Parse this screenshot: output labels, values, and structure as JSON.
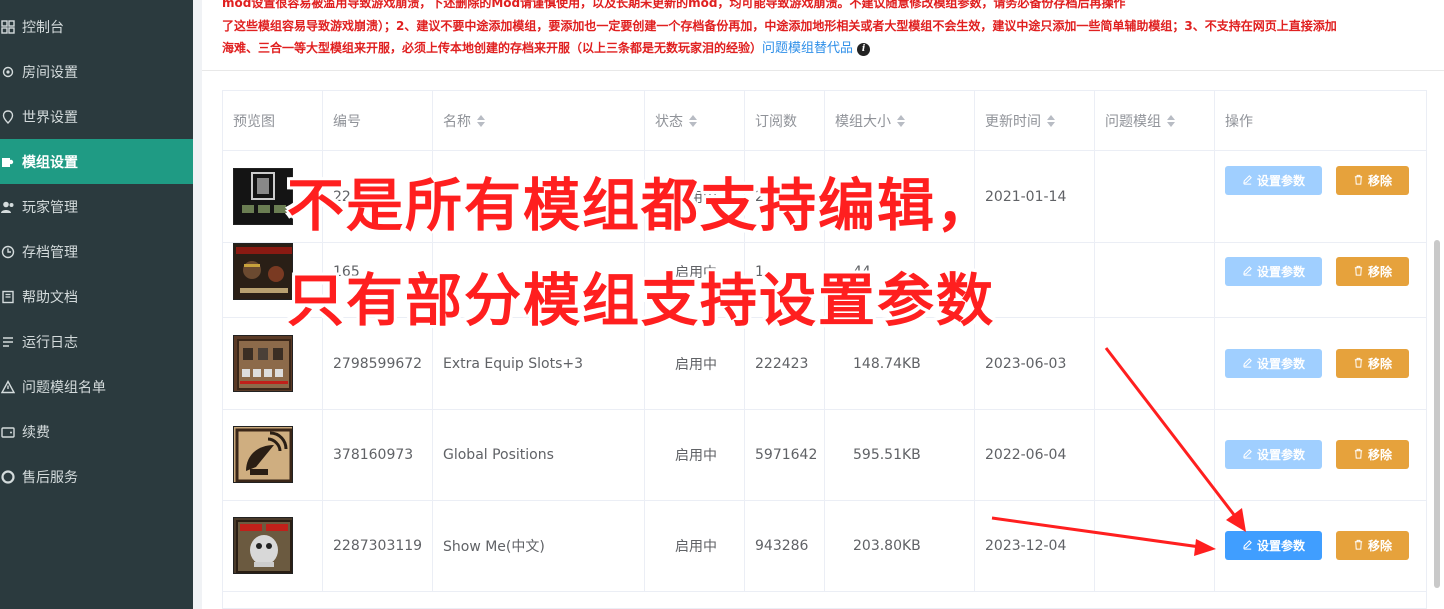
{
  "sidebar": {
    "items": [
      {
        "label": "控制台",
        "icon": "dashboard-icon",
        "active": false
      },
      {
        "label": "房间设置",
        "icon": "gear-icon",
        "active": false
      },
      {
        "label": "世界设置",
        "icon": "location-pin-icon",
        "active": false
      },
      {
        "label": "模组设置",
        "icon": "puzzle-icon",
        "active": true
      },
      {
        "label": "玩家管理",
        "icon": "users-icon",
        "active": false
      },
      {
        "label": "存档管理",
        "icon": "clock-icon",
        "active": false
      },
      {
        "label": "帮助文档",
        "icon": "book-icon",
        "active": false
      },
      {
        "label": "运行日志",
        "icon": "log-icon",
        "active": false
      },
      {
        "label": "问题模组名单",
        "icon": "alert-icon",
        "active": false
      },
      {
        "label": "续费",
        "icon": "wallet-icon",
        "active": false
      },
      {
        "label": "售后服务",
        "icon": "support-icon",
        "active": false
      }
    ]
  },
  "notice": {
    "line1": "mod设置很容易被滥用导致游戏崩溃，下述删除的Mod请谨慎使用，以及长期未更新的mod，均可能导致游戏崩溃。不建议随意修改模组参数，请务必备份存档后再操作",
    "line2": "了这些模组容易导致游戏崩溃）；2、建议不要中途添加模组，要添加也一定要创建一个存档备份再加，中途添加地形相关或者大型模组不会生效，建议中途只添加一些简单辅助模组；3、不支持在网页上直接添加",
    "line3": "海难、三合一等大型模组来开服，必须上传本地创建的存档来开服（以上三条都是无数玩家泪的经验）",
    "link": "问题模组替代品"
  },
  "table": {
    "headers": {
      "preview": "预览图",
      "id": "编号",
      "name": "名称",
      "status": "状态",
      "subs": "订阅数",
      "size": "模组大小",
      "updated": "更新时间",
      "problem": "问题模组",
      "actions": "操作"
    },
    "rows": [
      {
        "id": "2216",
        "name": "",
        "status": "启用中",
        "subs": "2186",
        "size": "",
        "updated": "2021-01-14",
        "thumb": "dark-box-icon",
        "editable": false
      },
      {
        "id": "165",
        "name": "",
        "status": "启用中",
        "subs": "1",
        "size": "44",
        "updated": "",
        "thumb": "health-bar-icon",
        "editable": false
      },
      {
        "id": "2798599672",
        "name": "Extra Equip Slots+3",
        "status": "启用中",
        "subs": "222423",
        "size": "148.74KB",
        "updated": "2023-06-03",
        "thumb": "equip-slots-icon",
        "editable": false
      },
      {
        "id": "378160973",
        "name": "Global Positions",
        "status": "启用中",
        "subs": "5971642",
        "size": "595.51KB",
        "updated": "2022-06-04",
        "thumb": "satellite-dish-icon",
        "editable": false
      },
      {
        "id": "2287303119",
        "name": "Show Me(中文)",
        "status": "启用中",
        "subs": "943286",
        "size": "203.80KB",
        "updated": "2023-12-04",
        "thumb": "show-me-icon",
        "editable": true
      }
    ],
    "edit_label": "设置参数",
    "remove_label": "移除"
  },
  "overlay": {
    "line1": "不是所有模组都支持编辑，",
    "line2": "只有部分模组支持设置参数"
  },
  "colors": {
    "sidebar_bg": "#2b3a3e",
    "active_bg": "#1f9b84",
    "notice_red": "#e02020",
    "primary": "#409eff",
    "primary_disabled": "#a0cfff",
    "warning": "#e6a23c",
    "overlay_red": "#ff1f1f"
  }
}
